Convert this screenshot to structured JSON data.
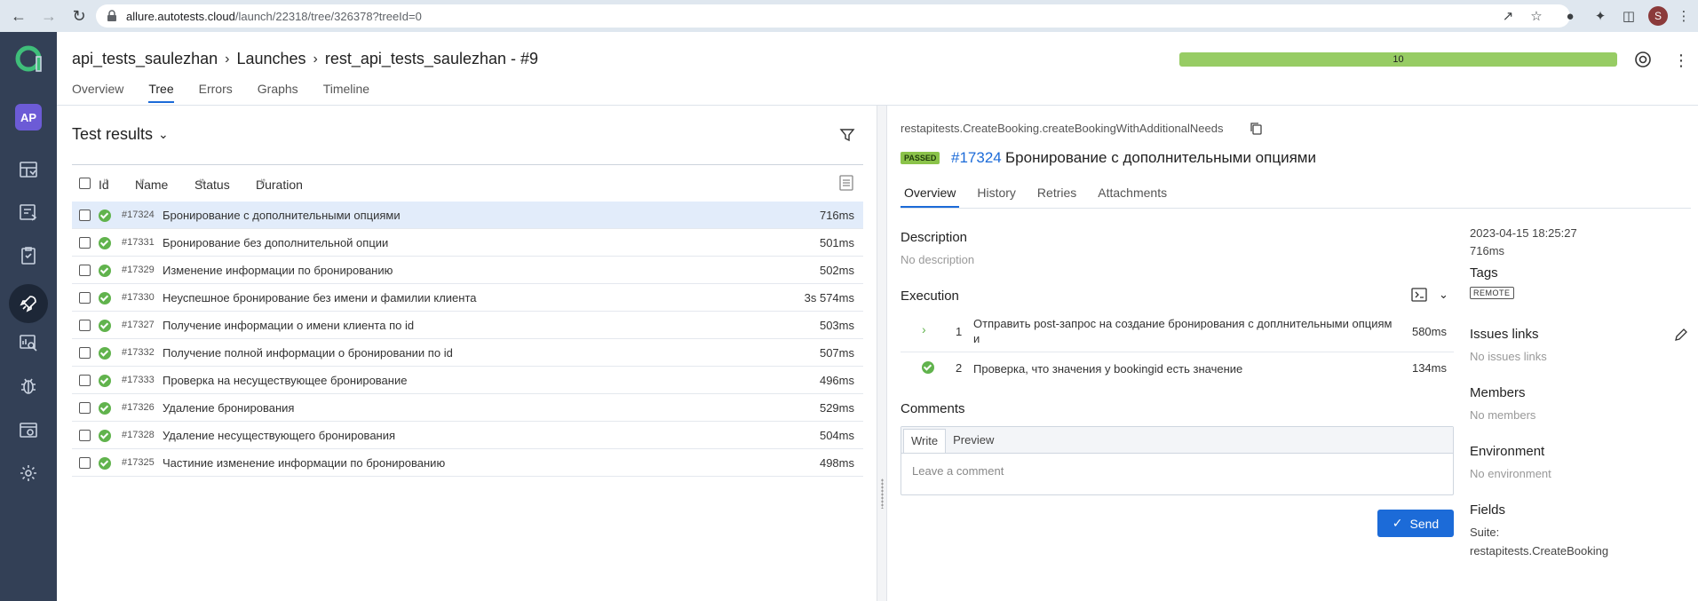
{
  "browser": {
    "url_host": "allure.autotests.cloud",
    "url_path": "/launch/22318/tree/326378?treeId=0",
    "profile_initial": "S"
  },
  "sidebar": {
    "avatar": "AP"
  },
  "header": {
    "breadcrumb": [
      "api_tests_saulezhan",
      "Launches",
      "rest_api_tests_saulezhan - #9"
    ],
    "progress_value": "10",
    "progress_fraction": 1.0,
    "tabs": [
      "Overview",
      "Tree",
      "Errors",
      "Graphs",
      "Timeline"
    ],
    "active_tab": "Tree"
  },
  "tree": {
    "title": "Test results",
    "columns": [
      "Id",
      "Name",
      "Status",
      "Duration"
    ],
    "rows": [
      {
        "id": "#17324",
        "name": "Бронирование с дополнительными опциями",
        "duration": "716ms",
        "selected": true
      },
      {
        "id": "#17331",
        "name": "Бронирование без дополнительной опции",
        "duration": "501ms"
      },
      {
        "id": "#17329",
        "name": "Изменение информации по бронированию",
        "duration": "502ms"
      },
      {
        "id": "#17330",
        "name": "Неуспешное бронирование без имени и фамилии клиента",
        "duration": "3s 574ms"
      },
      {
        "id": "#17327",
        "name": "Получение информации о имени клиента по id",
        "duration": "503ms"
      },
      {
        "id": "#17332",
        "name": "Получение полной информации о бронировании по id",
        "duration": "507ms"
      },
      {
        "id": "#17333",
        "name": "Проверка на несуществующее бронирование",
        "duration": "496ms"
      },
      {
        "id": "#17326",
        "name": "Удаление бронирования",
        "duration": "529ms"
      },
      {
        "id": "#17328",
        "name": "Удаление несуществующего бронирования",
        "duration": "504ms"
      },
      {
        "id": "#17325",
        "name": "Частиние изменение информации по бронированию",
        "duration": "498ms"
      }
    ]
  },
  "detail": {
    "full_name": "restapitests.CreateBooking.createBookingWithAdditionalNeeds",
    "status": "PASSED",
    "test_id": "#17324",
    "test_name": "Бронирование с дополнительными опциями",
    "tabs": [
      "Overview",
      "History",
      "Retries",
      "Attachments"
    ],
    "description_title": "Description",
    "description_value": "No description",
    "execution_title": "Execution",
    "steps": [
      {
        "num": "1",
        "text": "Отправить post-запрос на создание бронирования с доплнительными опциям и",
        "duration": "580ms"
      },
      {
        "num": "2",
        "text": "Проверка, что значения у bookingid есть значение",
        "duration": "134ms"
      }
    ],
    "comments_title": "Comments",
    "comment_tabs": [
      "Write",
      "Preview"
    ],
    "comment_placeholder": "Leave a comment",
    "send_label": "Send",
    "meta": {
      "datetime": "2023-04-15 18:25:27",
      "duration": "716ms",
      "tags_title": "Tags",
      "tag": "REMOTE",
      "issues_title": "Issues links",
      "issues_value": "No issues links",
      "members_title": "Members",
      "members_value": "No members",
      "environment_title": "Environment",
      "environment_value": "No environment",
      "fields_title": "Fields",
      "fields_label": "Suite:",
      "fields_value": "restapitests.CreateBooking"
    }
  },
  "colors": {
    "sidebar": "#334056",
    "accent": "#1c6bd8",
    "passed": "#61b34d",
    "progress": "#97cc64"
  }
}
